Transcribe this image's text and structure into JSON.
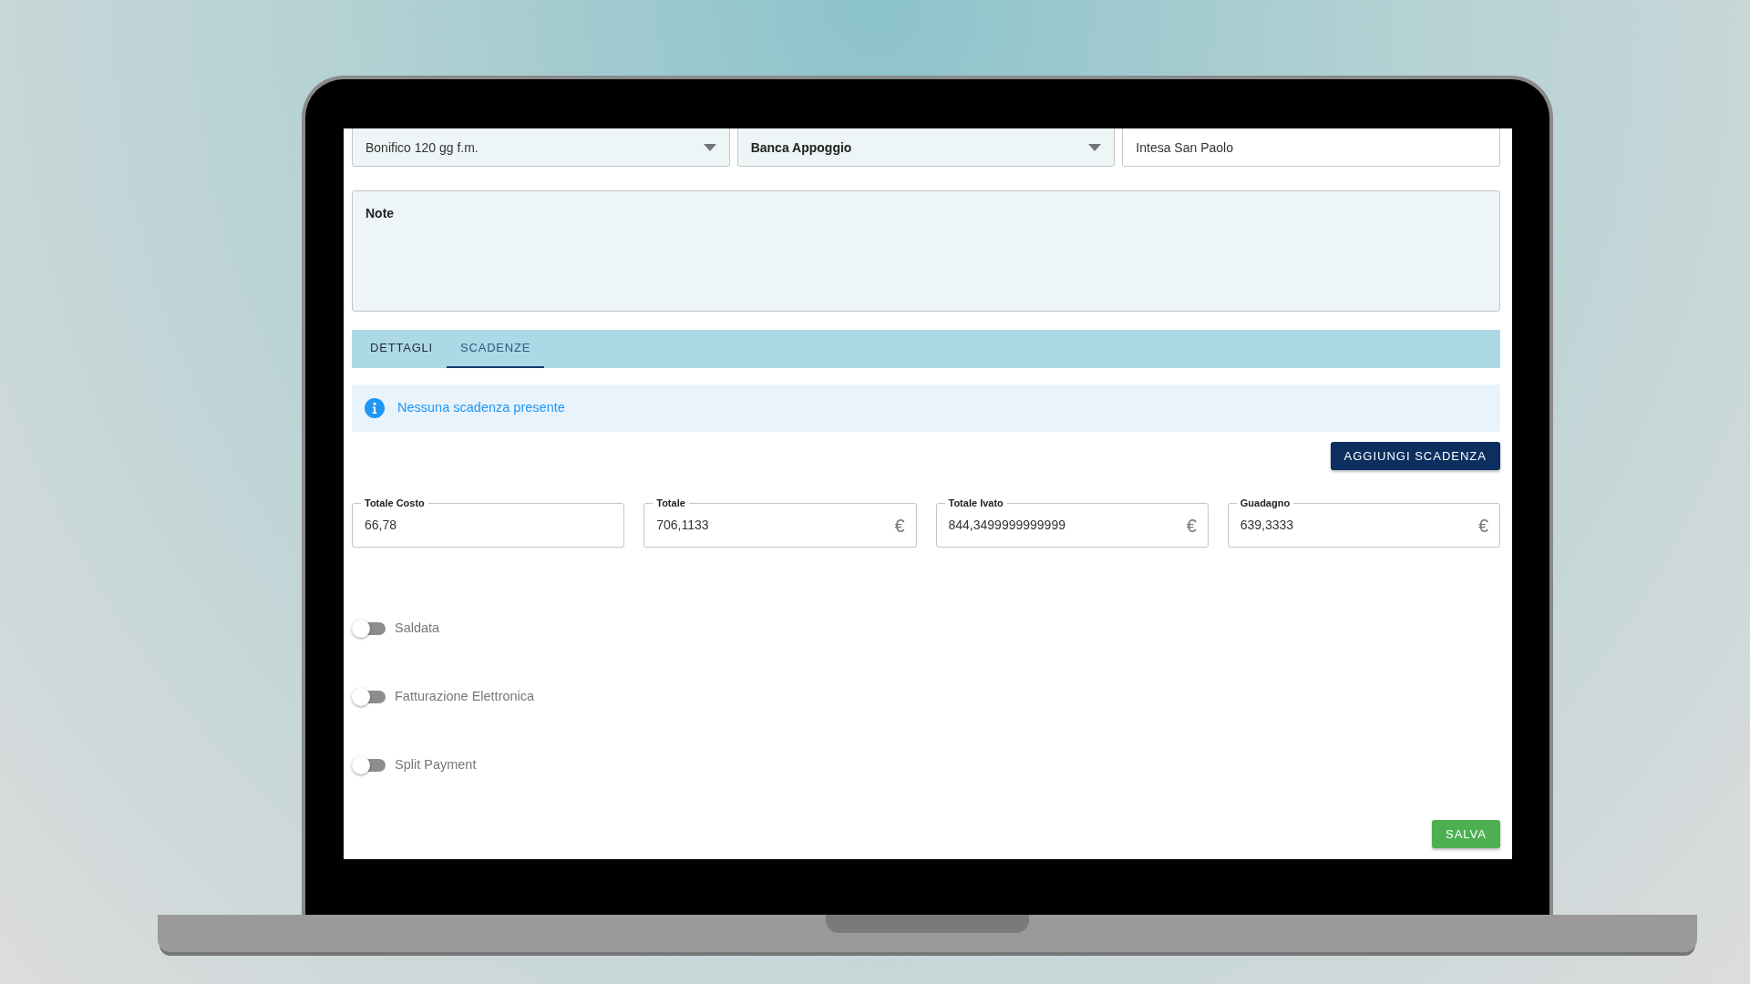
{
  "top_fields": [
    {
      "kind": "select",
      "value": "Bonifico 120 gg f.m."
    },
    {
      "kind": "select",
      "placeholder": "Banca Appoggio"
    },
    {
      "kind": "text",
      "value": "Intesa San Paolo"
    }
  ],
  "note": {
    "label": "Note"
  },
  "tabs": [
    {
      "label": "DETTAGLI",
      "selected": false
    },
    {
      "label": "SCADENZE",
      "selected": true
    }
  ],
  "alert": {
    "text": "Nessuna scadenza presente"
  },
  "add_button": "AGGIUNGI SCADENZA",
  "totals": [
    {
      "label": "Totale Costo",
      "value": "66,78"
    },
    {
      "label": "Totale",
      "value": "706,1133",
      "unit": "€"
    },
    {
      "label": "Totale Ivato",
      "value": "844,3499999999999",
      "unit": "€"
    },
    {
      "label": "Guadagno",
      "value": "639,3333",
      "unit": "€"
    }
  ],
  "switches": [
    {
      "label": "Saldata",
      "on": false
    },
    {
      "label": "Fatturazione Elettronica",
      "on": false
    },
    {
      "label": "Split Payment",
      "on": false
    }
  ],
  "save_button": "SALVA"
}
